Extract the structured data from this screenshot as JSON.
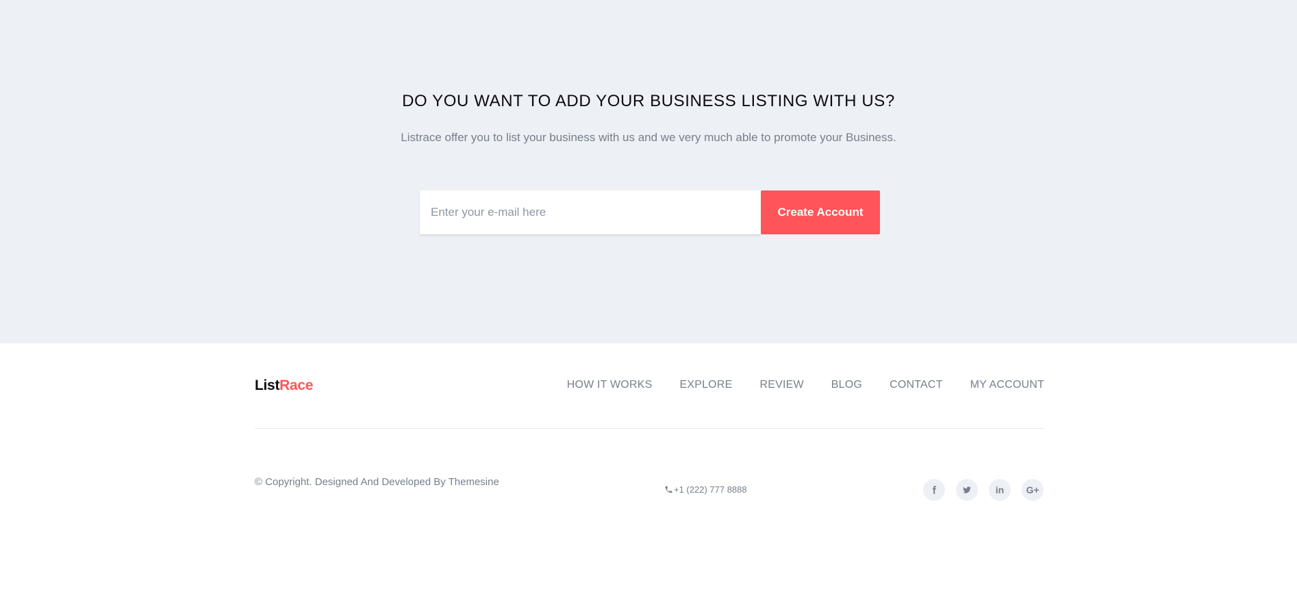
{
  "hero": {
    "title": "DO YOU WANT TO ADD YOUR BUSINESS LISTING WITH US?",
    "subtitle": "Listrace offer you to list your business with us and we very much able to promote your Business.",
    "email_placeholder": "Enter your e-mail here",
    "email_value": "",
    "button_label": "Create Account"
  },
  "footer": {
    "logo_part1": "List",
    "logo_part2": "Race",
    "nav": [
      "HOW IT WORKS",
      "EXPLORE",
      "REVIEW",
      "BLOG",
      "CONTACT",
      "MY ACCOUNT"
    ],
    "copyright": "© Copyright. Designed And Developed By Themesine",
    "phone": "+1 (222) 777 8888",
    "socials": [
      {
        "icon": "facebook-icon"
      },
      {
        "icon": "twitter-icon"
      },
      {
        "icon": "linkedin-icon",
        "glyph": "in"
      },
      {
        "icon": "google-plus-icon",
        "glyph": "G+"
      }
    ]
  },
  "colors": {
    "accent": "#ff545a",
    "hero_bg": "#edf0f5",
    "text_muted": "#767f8b",
    "heading": "#0b0b12"
  }
}
